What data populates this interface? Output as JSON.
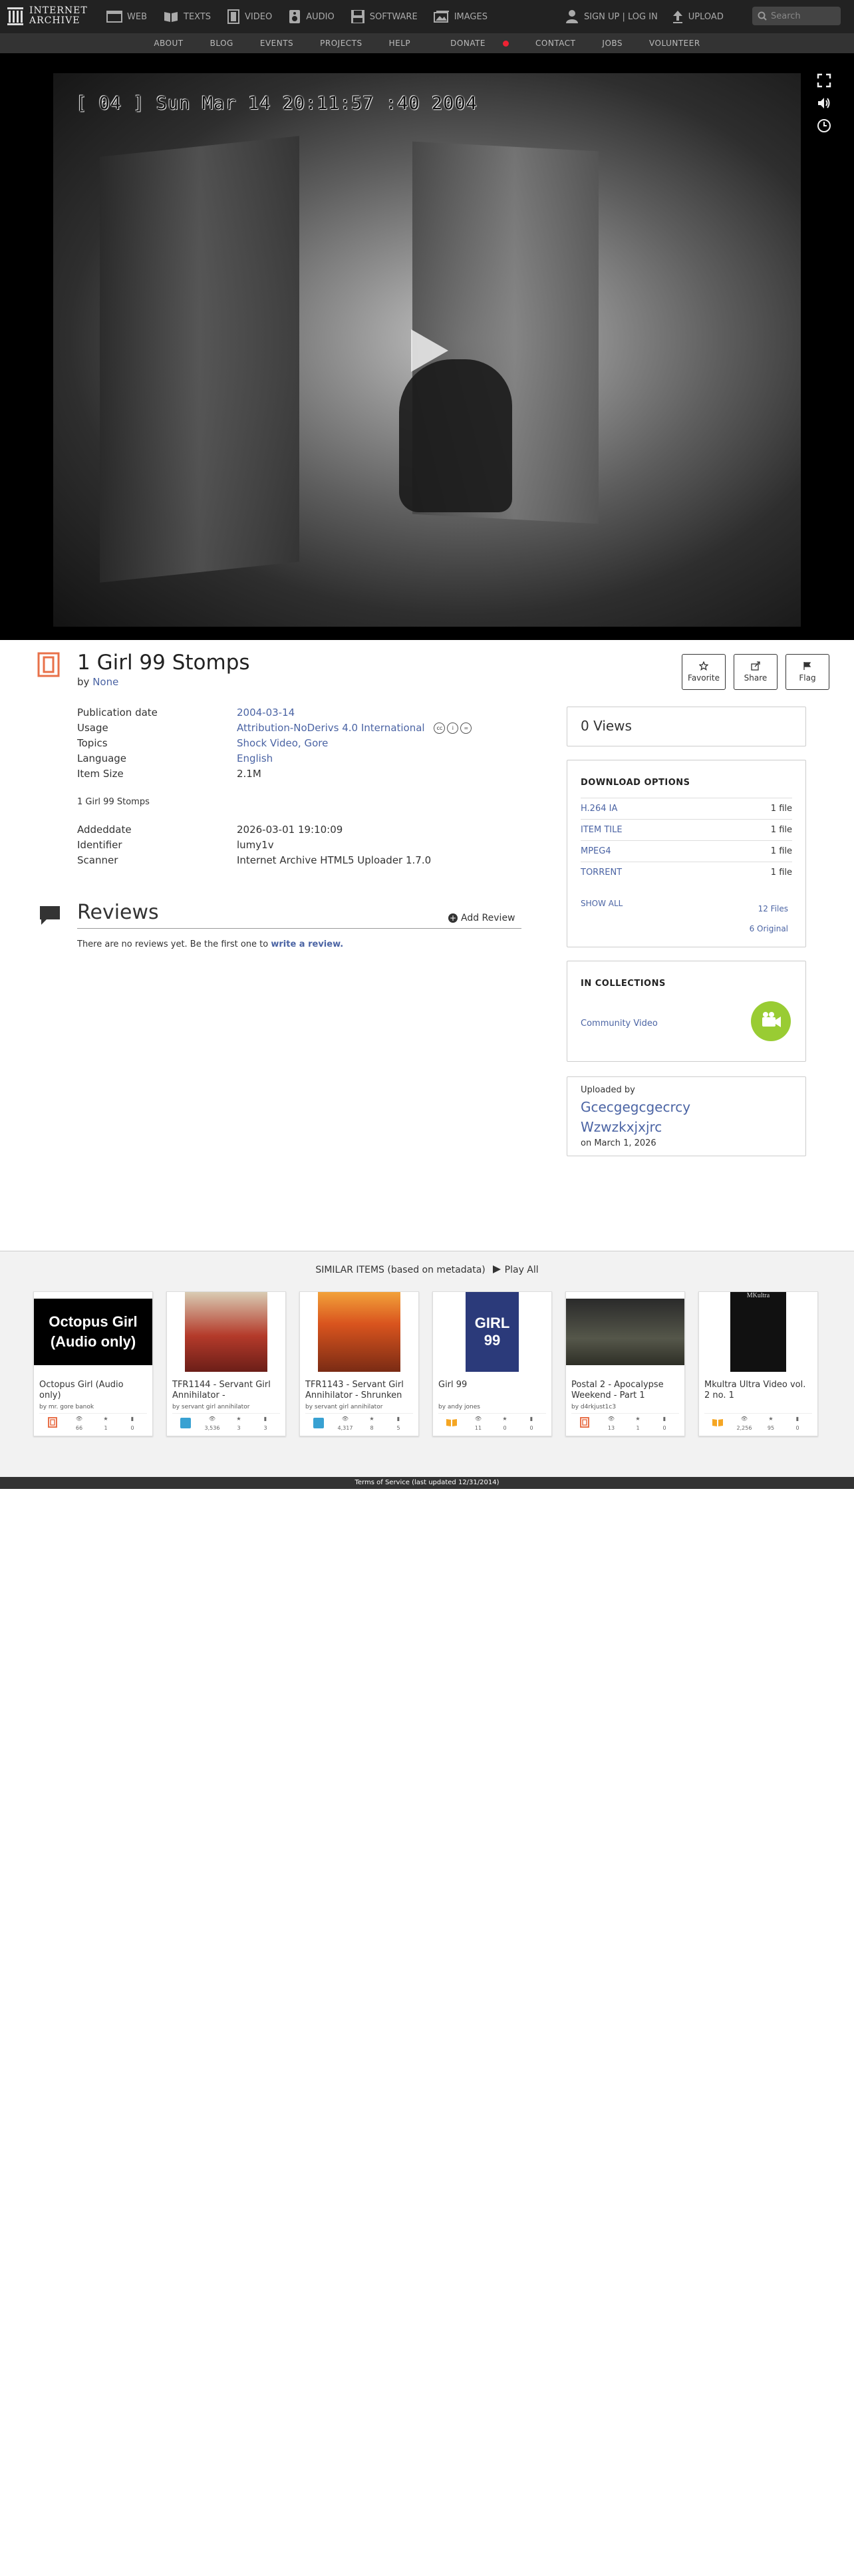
{
  "header": {
    "logo_text_1": "INTERNET",
    "logo_text_2": "ARCHIVE",
    "media_nav": [
      {
        "label": "WEB",
        "icon": "web-icon"
      },
      {
        "label": "TEXTS",
        "icon": "book-icon"
      },
      {
        "label": "VIDEO",
        "icon": "film-icon"
      },
      {
        "label": "AUDIO",
        "icon": "speaker-icon"
      },
      {
        "label": "SOFTWARE",
        "icon": "floppy-icon"
      },
      {
        "label": "IMAGES",
        "icon": "image-icon"
      }
    ],
    "signup": "SIGN UP | LOG IN",
    "upload": "UPLOAD",
    "search_placeholder": "Search"
  },
  "subnav": [
    "ABOUT",
    "BLOG",
    "EVENTS",
    "PROJECTS",
    "HELP",
    "DONATE",
    "CONTACT",
    "JOBS",
    "VOLUNTEER"
  ],
  "player": {
    "timestamp_overlay": "[ 04 ] Sun Mar 14 20:11:57 :40 2004"
  },
  "item": {
    "title": "1 Girl 99 Stomps",
    "by_label": "by",
    "by_value": "None",
    "actions": {
      "favorite": "Favorite",
      "share": "Share",
      "flag": "Flag"
    },
    "metadata": [
      {
        "key": "Publication date",
        "value": "2004-03-14"
      },
      {
        "key": "Usage",
        "value": "Attribution-NoDerivs 4.0 International"
      },
      {
        "key": "Topics",
        "value": "Shock Video, Gore"
      },
      {
        "key": "Language",
        "value": "English"
      },
      {
        "key": "Item Size",
        "value": "2.1M"
      }
    ],
    "description": "1 Girl 99 Stomps",
    "metadata2": [
      {
        "key": "Addeddate",
        "value": "2026-03-01 19:10:09"
      },
      {
        "key": "Identifier",
        "value": "lumy1v"
      },
      {
        "key": "Scanner",
        "value": "Internet Archive HTML5 Uploader 1.7.0"
      }
    ]
  },
  "reviews": {
    "title": "Reviews",
    "add_label": "Add Review",
    "empty_text": "There are no reviews yet. Be the first one to",
    "empty_link": "write a review."
  },
  "sidebar": {
    "views": "0 Views",
    "download_title": "DOWNLOAD OPTIONS",
    "downloads": [
      {
        "format": "H.264 IA",
        "count": "1 file"
      },
      {
        "format": "ITEM TILE",
        "count": "1 file"
      },
      {
        "format": "MPEG4",
        "count": "1 file"
      },
      {
        "format": "TORRENT",
        "count": "1 file"
      }
    ],
    "show_all": "SHOW ALL",
    "files_total": "12 Files",
    "files_original": "6 Original",
    "collections_title": "IN COLLECTIONS",
    "collection_name": "Community Video",
    "uploaded_by_label": "Uploaded by",
    "uploader": "Gcecgegcgecrcy Wzwzkxjxjrc",
    "upload_date": "on March 1, 2026"
  },
  "similar": {
    "heading": "SIMILAR ITEMS (based on metadata)",
    "play_all": "Play All",
    "items": [
      {
        "title": "Octopus Girl (Audio only)",
        "by": "by mr. gore banok",
        "views": "66",
        "favs": "1",
        "reviews": "0",
        "type_color": "#e8714a",
        "thumb_text": "Octopus Girl (Audio only)"
      },
      {
        "title": "TFR1144 - Servant Girl Annihilator -",
        "by": "by servant girl annihilator",
        "views": "3,536",
        "favs": "3",
        "reviews": "3",
        "type_color": "#38a1d2",
        "thumb_text": ""
      },
      {
        "title": "TFR1143 - Servant Girl Annihilator - Shrunken",
        "by": "by servant girl annihilator",
        "views": "4,317",
        "favs": "8",
        "reviews": "5",
        "type_color": "#38a1d2",
        "thumb_text": ""
      },
      {
        "title": "Girl 99",
        "by": "by andy jones",
        "views": "11",
        "favs": "0",
        "reviews": "0",
        "type_color": "#f5a623",
        "thumb_text": "GIRL 99"
      },
      {
        "title": "Postal 2 - Apocalypse Weekend - Part 1",
        "by": "by d4rkjust1c3",
        "views": "13",
        "favs": "1",
        "reviews": "0",
        "type_color": "#e8714a",
        "thumb_text": ""
      },
      {
        "title": "Mkultra Ultra Video vol. 2 no. 1",
        "by": "",
        "views": "2,256",
        "favs": "95",
        "reviews": "0",
        "type_color": "#f5a623",
        "thumb_text": "MKultra"
      }
    ]
  },
  "footer": "Terms of Service (last updated 12/31/2014)"
}
